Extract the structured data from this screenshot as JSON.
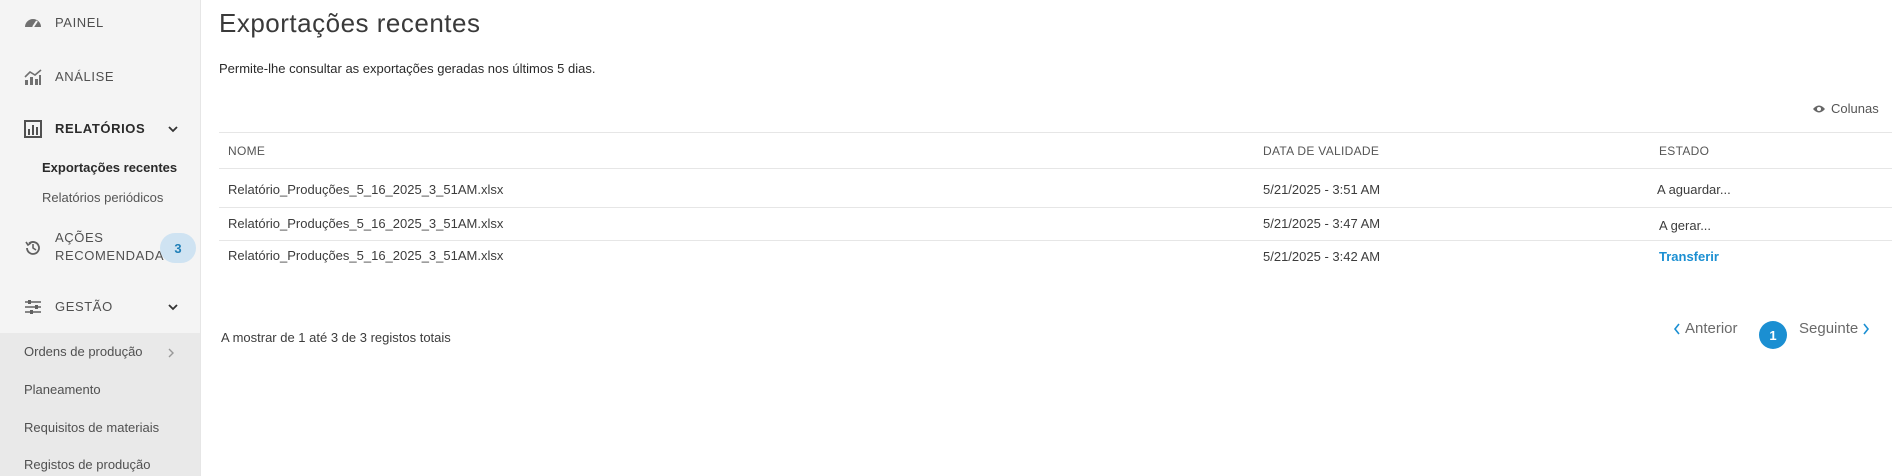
{
  "sidebar": {
    "painel": "PAINEL",
    "analise": "ANÁLISE",
    "relatorios": "RELATÓRIOS",
    "relatorios_sub": [
      "Exportações recentes",
      "Relatórios periódicos"
    ],
    "acoes_line1": "AÇÕES",
    "acoes_line2": "RECOMENDADAS",
    "acoes_badge": "3",
    "gestao": "GESTÃO",
    "gestao_sub": [
      "Ordens de produção",
      "Planeamento",
      "Requisitos de materiais",
      "Registos de produção"
    ]
  },
  "page": {
    "title": "Exportações recentes",
    "description": "Permite-lhe consultar as exportações geradas nos últimos 5 dias.",
    "columns_button": "Colunas"
  },
  "table": {
    "headers": [
      "NOME",
      "DATA DE VALIDADE",
      "ESTADO"
    ],
    "rows": [
      {
        "name": "Relatório_Produções_5_16_2025_3_51AM.xlsx",
        "expiry": "5/21/2025 - 3:51 AM",
        "status": "A aguardar..."
      },
      {
        "name": "Relatório_Produções_5_16_2025_3_51AM.xlsx",
        "expiry": "5/21/2025 - 3:47 AM",
        "status": "A gerar..."
      },
      {
        "name": "Relatório_Produções_5_16_2025_3_51AM.xlsx",
        "expiry": "5/21/2025 - 3:42 AM",
        "status": "Transferir"
      }
    ]
  },
  "footer": {
    "summary": "A mostrar de 1 até 3 de 3 registos totais",
    "prev": "Anterior",
    "page": "1",
    "next": "Seguinte"
  },
  "colors": {
    "accent": "#1b8fd2",
    "badge_bg": "#cfe3f2",
    "sidebar_bg": "#f4f4f4"
  },
  "icons": [
    "dashboard-icon",
    "analytics-icon",
    "reports-icon",
    "history-icon",
    "sliders-icon",
    "chevron-down-icon",
    "chevron-right-icon",
    "eye-icon",
    "chevron-left-icon"
  ]
}
